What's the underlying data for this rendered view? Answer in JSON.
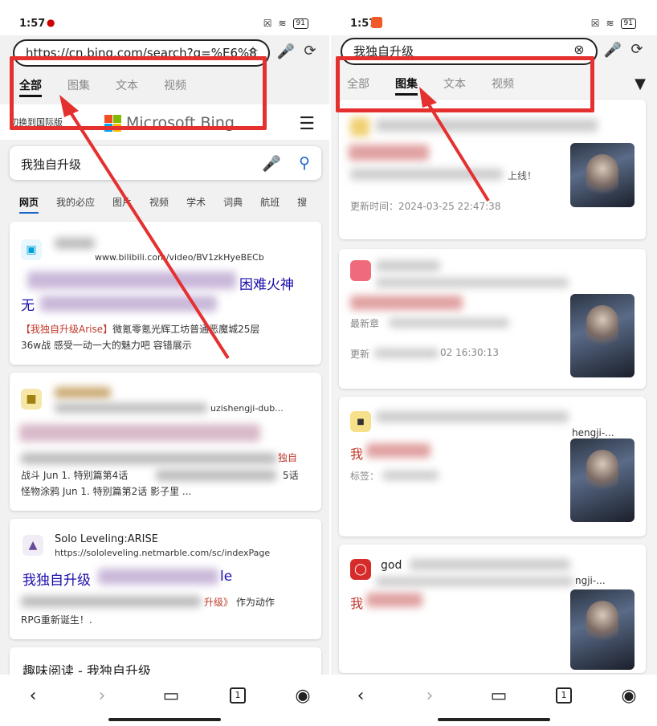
{
  "left": {
    "status": {
      "time": "1:57",
      "battery": "91"
    },
    "address_bar": {
      "url": "https://cn.bing.com/search?q=%E6%8"
    },
    "tabs": [
      "全部",
      "图集",
      "文本",
      "视频"
    ],
    "active_tab": "全部",
    "bing": {
      "switch_intl": "切换到国际版",
      "logo_text": "Microsoft Bing"
    },
    "search": {
      "query": "我独自升级"
    },
    "scopes": [
      "网页",
      "我的必应",
      "图片",
      "视频",
      "学术",
      "词典",
      "航班",
      "搜"
    ],
    "results": [
      {
        "url": "www.bilibili.com/video/BV1zkHyeBECb",
        "title_visible_end": "困难火神",
        "title_line2_start": "无",
        "snippet_hl": "【我独自升级Arise】",
        "snippet_rest": "微氪零氪光辉工坊普通恶魔城25层",
        "snippet_line2": "36w战 感受一动一大的魅力吧 容错展示"
      },
      {
        "url_fragment": "uzishengji-dub...",
        "snippet_tail": "独自",
        "snippet_line2": "战斗 Jun 1. 特别篇第4话",
        "snippet_line2_end": "5话",
        "snippet_line3": "怪物涂鸦 Jun 1. 特别篇第2话 影子里 ..."
      },
      {
        "site_name": "Solo Leveling:ARISE",
        "url": "https://sololeveling.netmarble.com/sc/indexPage",
        "title_start": "我独自升级",
        "title_end": "le",
        "snippet_hl": "升级》",
        "snippet_rest": "作为动作",
        "snippet_line2": "RPG重新诞生！."
      },
      {
        "title": "趣味阅读 - 我独自升级"
      }
    ],
    "nav": {
      "tab_count": "1"
    }
  },
  "right": {
    "status": {
      "time": "1:57",
      "battery": "91"
    },
    "search": {
      "query": "我独自升级"
    },
    "tabs": [
      "全部",
      "图集",
      "文本",
      "视频"
    ],
    "active_tab": "图集",
    "results": [
      {
        "snippet_end": "上线！",
        "updated": "更新时间：2024-03-25 22:47:38"
      },
      {
        "meta1": "最新章",
        "meta2_start": "更新",
        "meta2_end": "02 16:30:13"
      },
      {
        "url_fragment": "hengji-...",
        "title_start": "我",
        "tag_label": "标签："
      },
      {
        "site_name": "god",
        "url_fragment": "ngji-...",
        "title_start": "我"
      }
    ],
    "nav": {
      "tab_count": "1"
    }
  },
  "colors": {
    "annotation_red": "#e53030",
    "bing_blue": "#1b65c9",
    "link_blue": "#1a0dab"
  }
}
